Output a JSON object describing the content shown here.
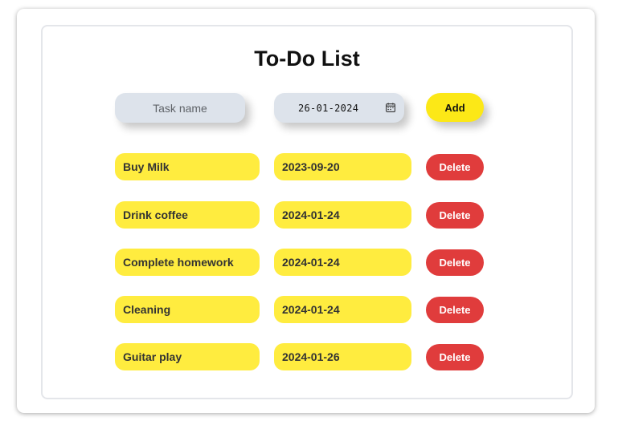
{
  "title": "To-Do List",
  "form": {
    "task_placeholder": "Task name",
    "task_value": "",
    "date_value": "26-01-2024",
    "add_label": "Add"
  },
  "tasks": [
    {
      "name": "Buy Milk",
      "date": "2023-09-20",
      "delete_label": "Delete"
    },
    {
      "name": "Drink coffee",
      "date": "2024-01-24",
      "delete_label": "Delete"
    },
    {
      "name": "Complete homework",
      "date": "2024-01-24",
      "delete_label": "Delete"
    },
    {
      "name": "Cleaning",
      "date": "2024-01-24",
      "delete_label": "Delete"
    },
    {
      "name": "Guitar play",
      "date": "2024-01-26",
      "delete_label": "Delete"
    }
  ],
  "icons": {
    "date_picker": "calendar-icon"
  },
  "colors": {
    "accent_yellow": "#fce817",
    "pill_yellow": "#ffec3f",
    "delete_red": "#e03c3c",
    "input_gray": "#dde3eb"
  }
}
